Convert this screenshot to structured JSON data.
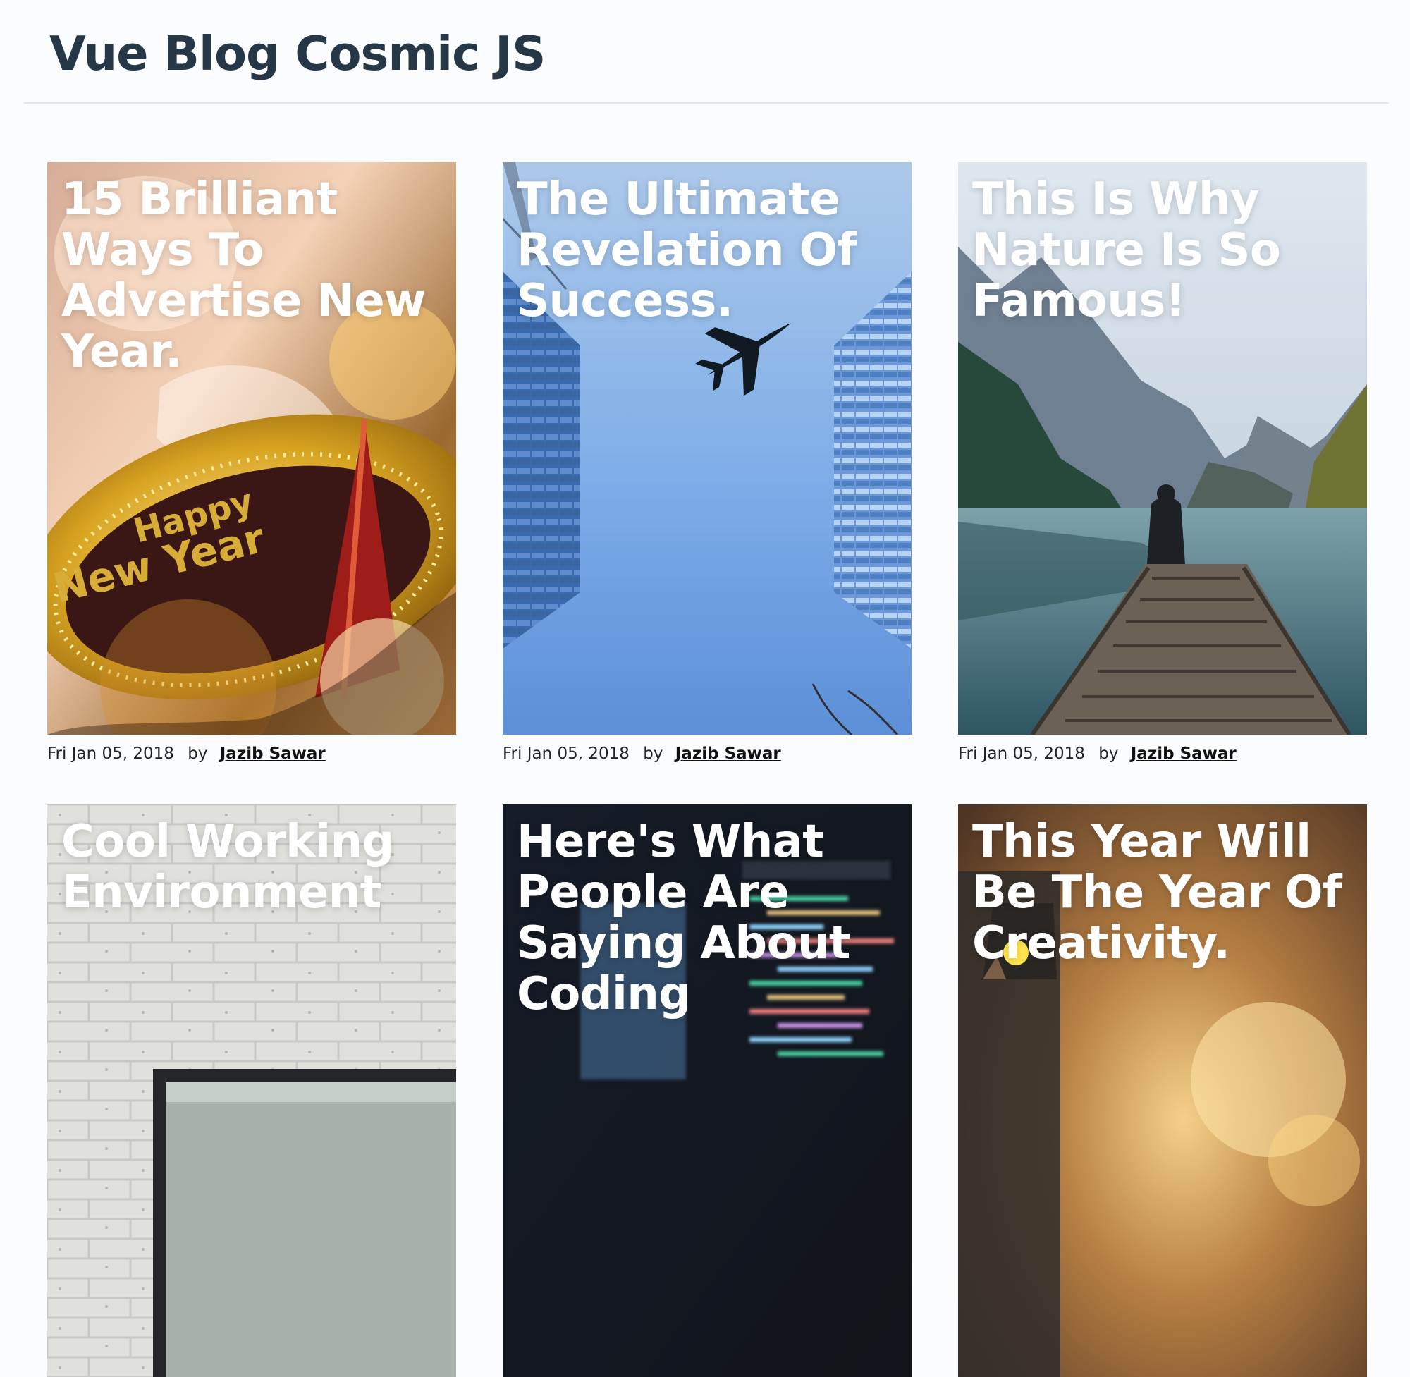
{
  "site": {
    "title": "Vue Blog Cosmic JS"
  },
  "posts": [
    {
      "title": "15 Brilliant Ways To Advertise New Year.",
      "date": "Fri Jan 05, 2018",
      "by_label": "by",
      "author": "Jazib Sawar",
      "image": "new-year-party-hat-image"
    },
    {
      "title": "The Ultimate Revelation Of Success.",
      "date": "Fri Jan 05, 2018",
      "by_label": "by",
      "author": "Jazib Sawar",
      "image": "airplane-between-buildings-image"
    },
    {
      "title": "This Is Why Nature Is So Famous!",
      "date": "Fri Jan 05, 2018",
      "by_label": "by",
      "author": "Jazib Sawar",
      "image": "mountain-lake-dock-image"
    },
    {
      "title": "Cool Working Environment",
      "image": "brick-wall-laptop-image"
    },
    {
      "title": "Here's What People Are Saying About Coding",
      "image": "code-screen-image"
    },
    {
      "title": "This Year Will Be The Year Of Creativity.",
      "image": "warm-desk-bokeh-image"
    }
  ],
  "colors": {
    "page_background": "#fbfcfd",
    "title_text": "#263747",
    "card_heading": "#ffffff",
    "meta_text": "#1d2428"
  }
}
